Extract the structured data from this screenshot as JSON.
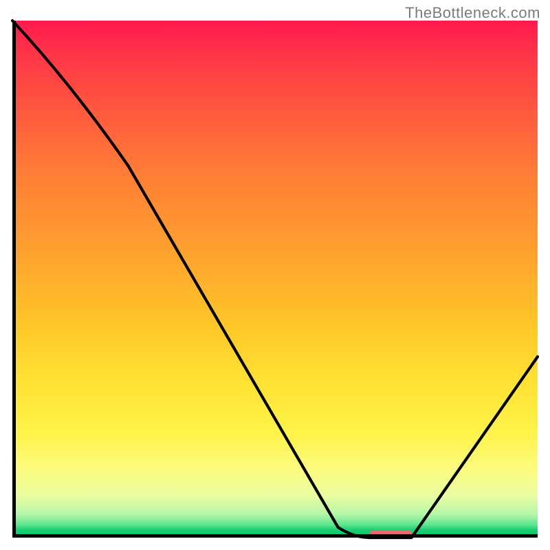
{
  "watermark": "TheBottleneck.com",
  "chart_data": {
    "type": "line",
    "title": "",
    "xlabel": "",
    "ylabel": "",
    "xlim": [
      0,
      100
    ],
    "ylim": [
      0,
      100
    ],
    "legend": false,
    "grid": false,
    "background_gradient": {
      "direction": "vertical",
      "stops": [
        {
          "pos": 0,
          "color": "#ff1a4d"
        },
        {
          "pos": 18,
          "color": "#ff5a3e"
        },
        {
          "pos": 45,
          "color": "#ffa22e"
        },
        {
          "pos": 70,
          "color": "#ffe233"
        },
        {
          "pos": 87,
          "color": "#fbfb80"
        },
        {
          "pos": 95,
          "color": "#b3f7a8"
        },
        {
          "pos": 100,
          "color": "#04c468"
        }
      ]
    },
    "series": [
      {
        "name": "bottleneck-curve",
        "x": [
          0,
          22,
          62,
          68,
          76,
          100
        ],
        "values": [
          100,
          72,
          2,
          0,
          0,
          35
        ]
      }
    ],
    "marker": {
      "name": "optimal-range",
      "x_start": 68,
      "x_end": 76,
      "y": 0,
      "color": "#e86a6f"
    }
  }
}
